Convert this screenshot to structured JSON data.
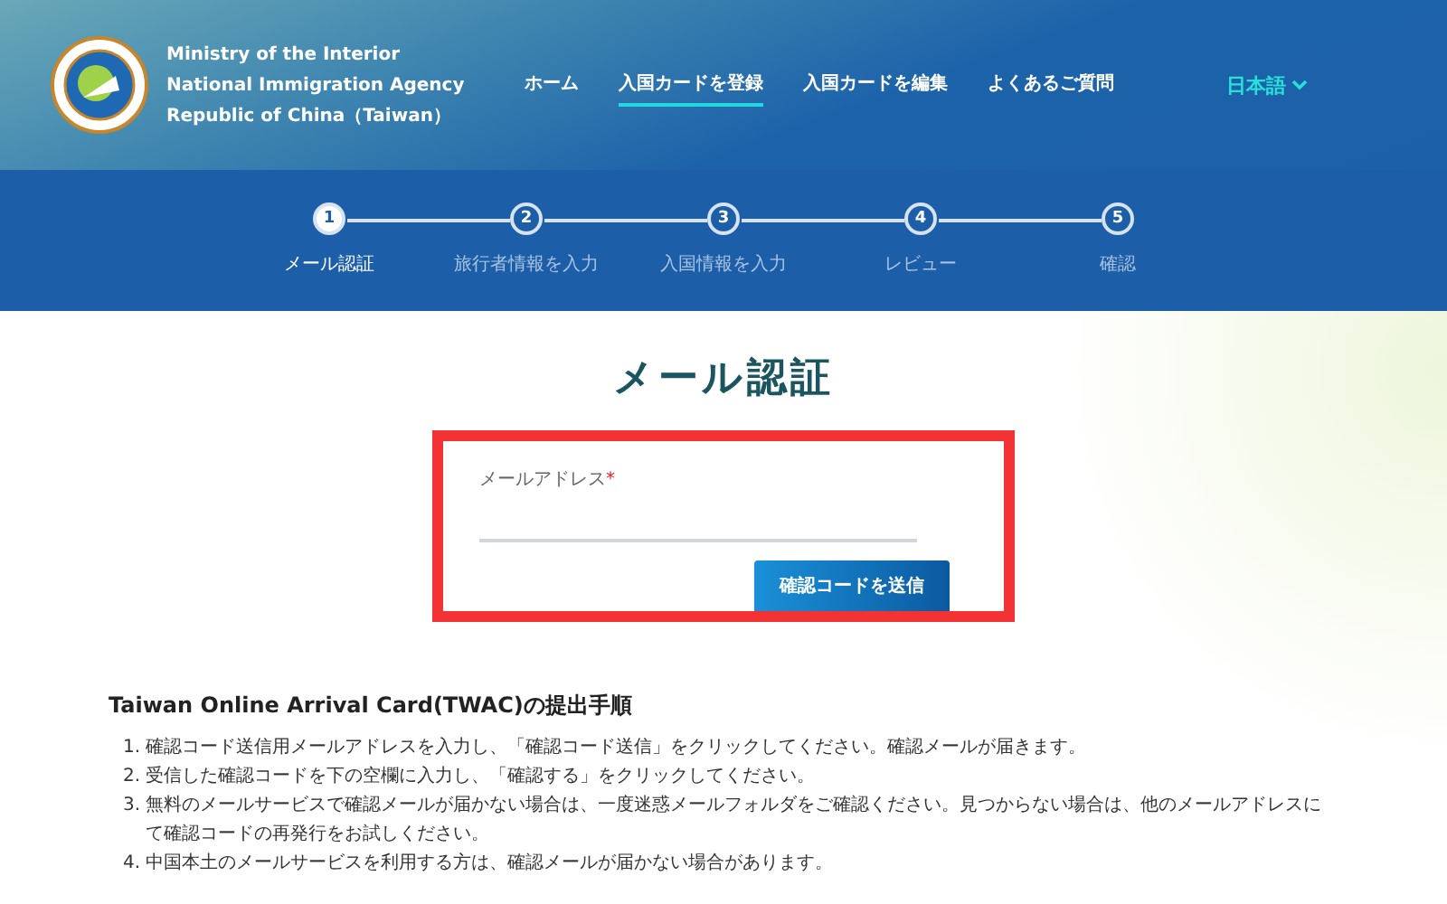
{
  "header": {
    "agency_lines": [
      "Ministry of the Interior",
      "National Immigration Agency",
      "Republic of China（Taiwan）"
    ],
    "nav": [
      {
        "label": "ホーム",
        "selected": false
      },
      {
        "label": "入国カードを登録",
        "selected": true
      },
      {
        "label": "入国カードを編集",
        "selected": false
      },
      {
        "label": "よくあるご質問",
        "selected": false
      }
    ],
    "language": "日本語"
  },
  "steps": [
    {
      "number": "1",
      "label": "メール認証",
      "selected": true
    },
    {
      "number": "2",
      "label": "旅行者情報を入力",
      "selected": false
    },
    {
      "number": "3",
      "label": "入国情報を入力",
      "selected": false
    },
    {
      "number": "4",
      "label": "レビュー",
      "selected": false
    },
    {
      "number": "5",
      "label": "確認",
      "selected": false
    }
  ],
  "title": "メール認証",
  "form": {
    "email_label": "メールアドレス",
    "required_mark": "*",
    "button": "確認コードを送信"
  },
  "instructions": {
    "heading": "Taiwan Online Arrival Card(TWAC)の提出手順",
    "items": [
      {
        "marker": "1.",
        "text": "確認コード送信用メールアドレスを入力し、「確認コード送信」をクリックしてください。確認メールが届きます。"
      },
      {
        "marker": "2.",
        "text": "受信した確認コードを下の空欄に入力し、「確認する」をクリックしてください。"
      },
      {
        "marker": "3.",
        "text": "無料のメールサービスで確認メールが届かない場合は、一度迷惑メールフォルダをご確認ください。見つからない場合は、他のメールアドレスにて確認コードの再発行をお試しください。"
      },
      {
        "marker": "4.",
        "text": "中国本土のメールサービスを利用する方は、確認メールが届かない場合があります。"
      }
    ]
  }
}
